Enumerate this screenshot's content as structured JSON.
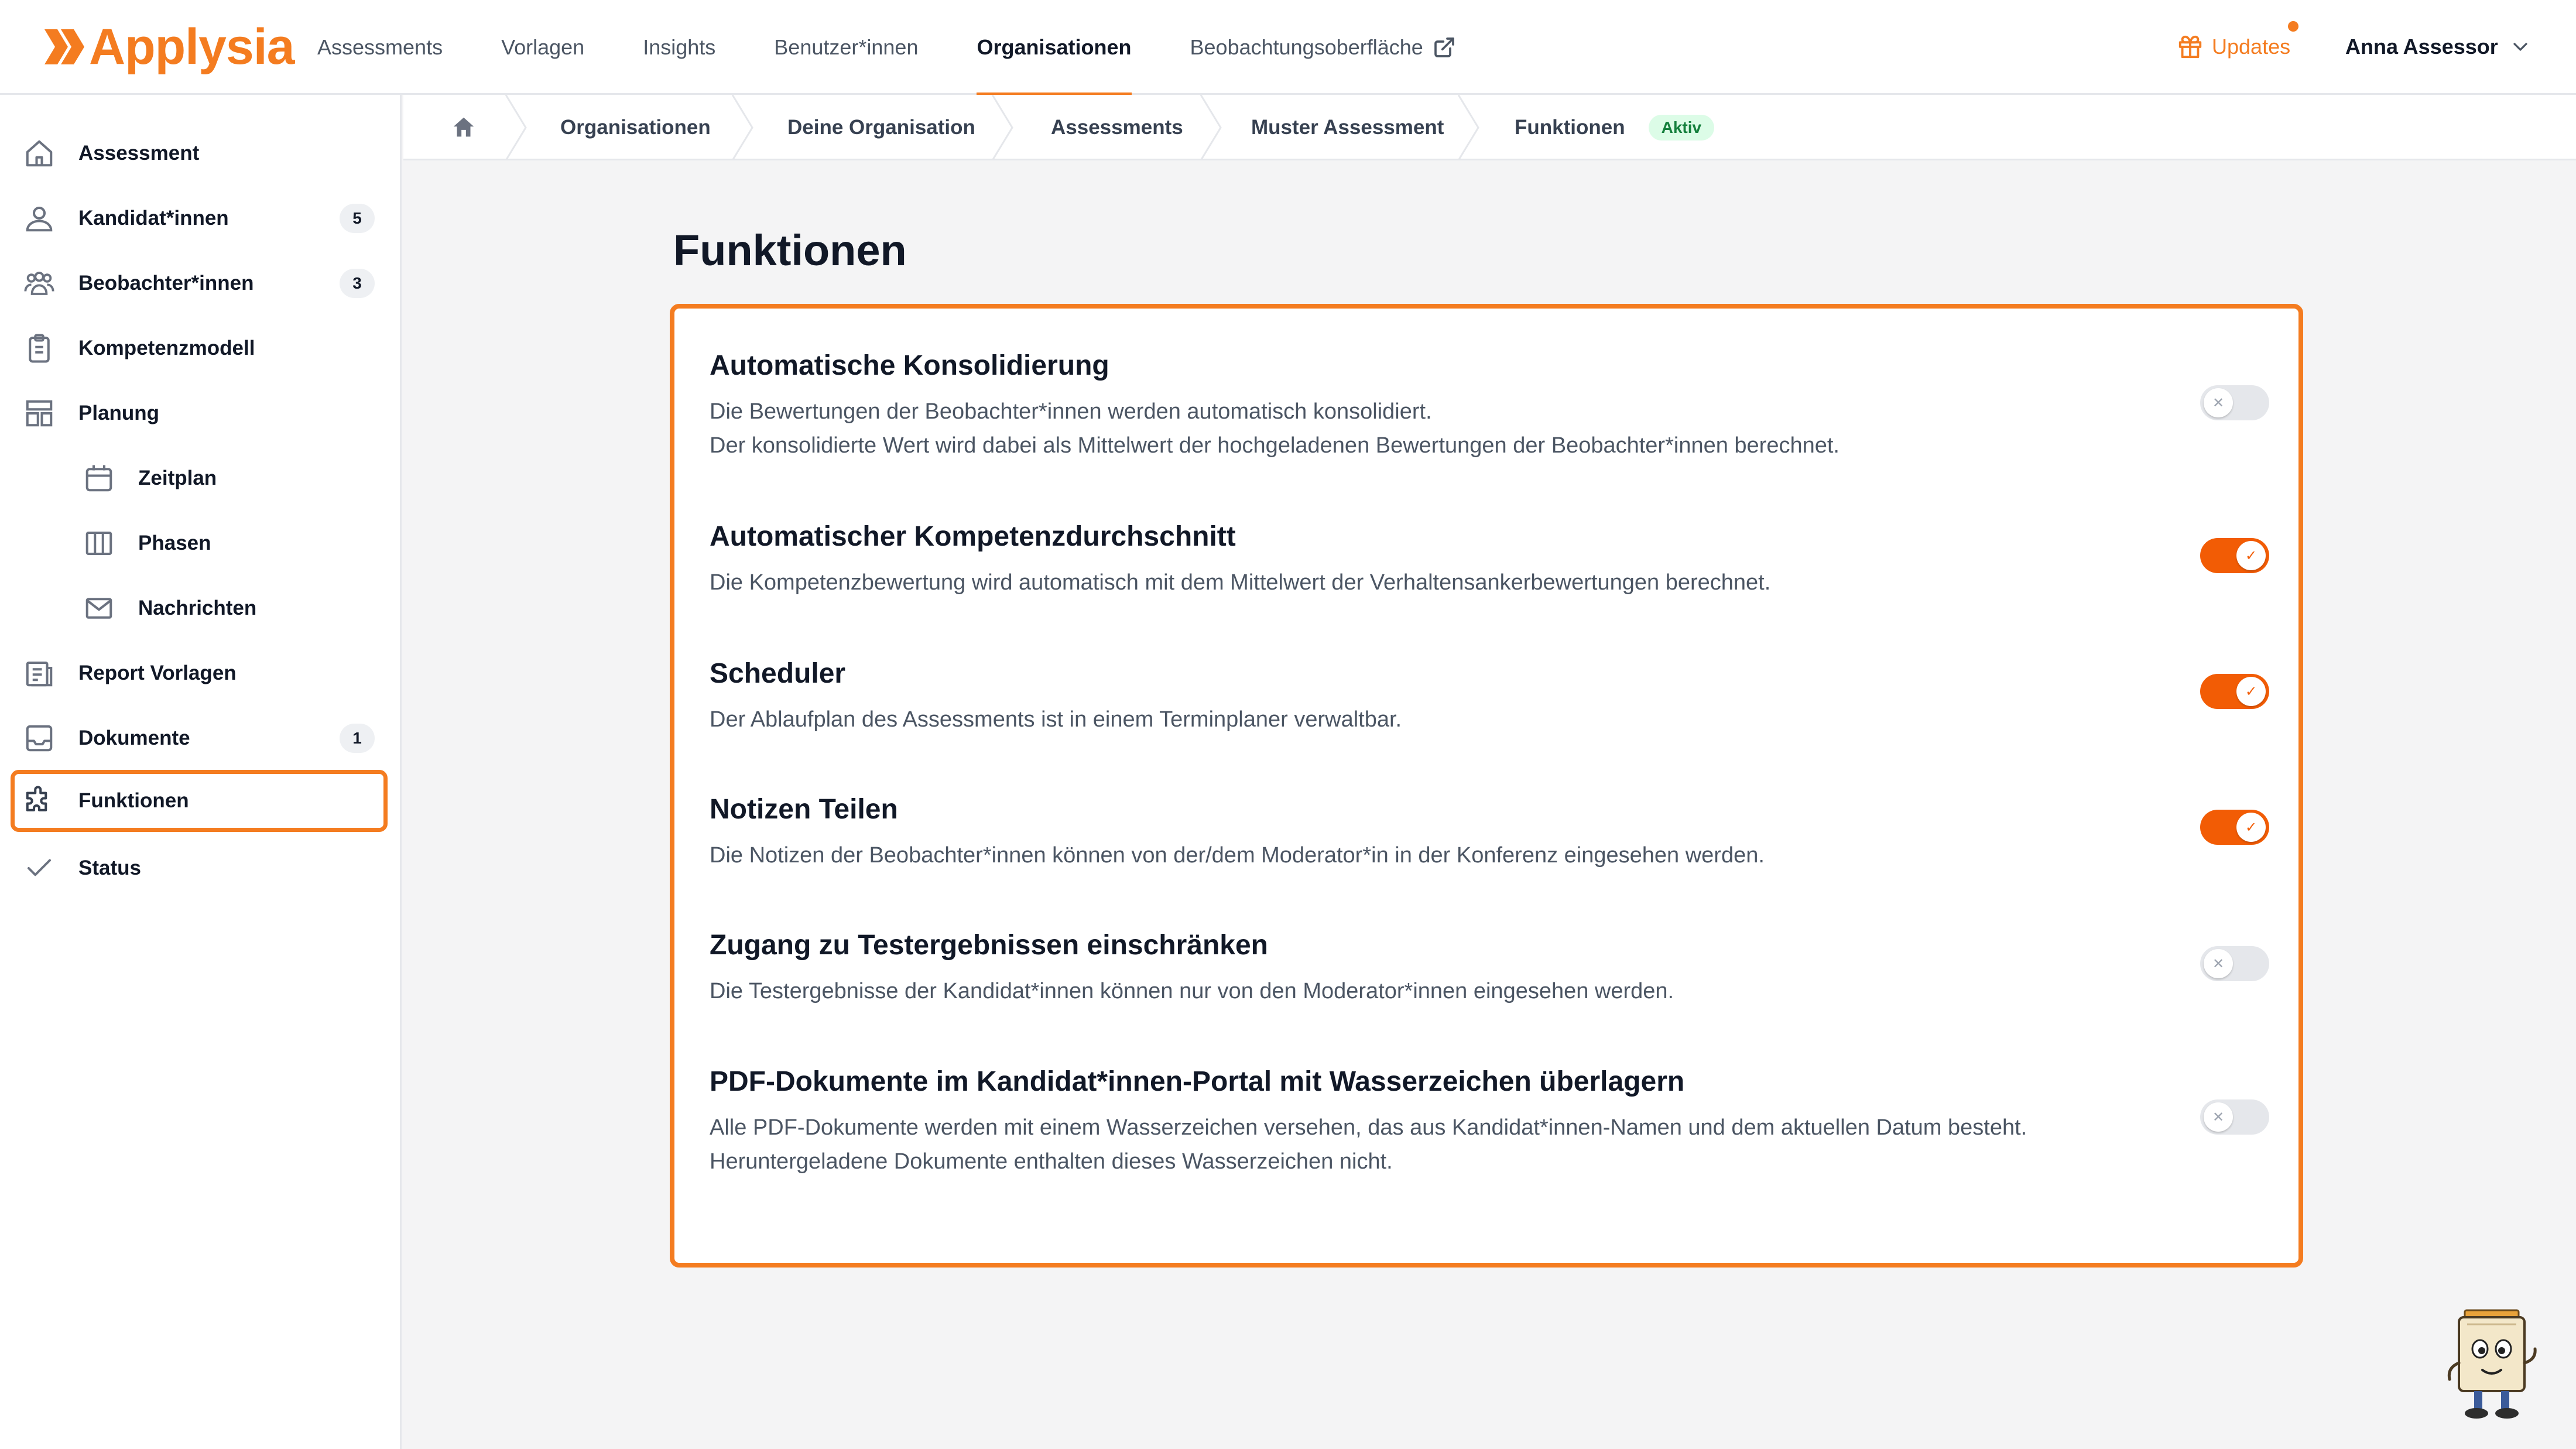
{
  "brand": {
    "name": "Applysia",
    "color": "#f47c20"
  },
  "nav": {
    "items": [
      {
        "label": "Assessments",
        "active": false
      },
      {
        "label": "Vorlagen",
        "active": false
      },
      {
        "label": "Insights",
        "active": false
      },
      {
        "label": "Benutzer*innen",
        "active": false
      },
      {
        "label": "Organisationen",
        "active": true
      },
      {
        "label": "Beobachtungsoberfläche",
        "active": false,
        "icon": "external-link-icon"
      }
    ],
    "updates_label": "Updates",
    "user_name": "Anna Assessor"
  },
  "sidebar": {
    "items": [
      {
        "label": "Assessment",
        "icon": "home-icon"
      },
      {
        "label": "Kandidat*innen",
        "icon": "user-icon",
        "badge": "5"
      },
      {
        "label": "Beobachter*innen",
        "icon": "users-icon",
        "badge": "3"
      },
      {
        "label": "Kompetenzmodell",
        "icon": "clipboard-icon"
      },
      {
        "label": "Planung",
        "icon": "layout-icon"
      },
      {
        "label": "Zeitplan",
        "icon": "calendar-icon",
        "sub": true
      },
      {
        "label": "Phasen",
        "icon": "columns-icon",
        "sub": true
      },
      {
        "label": "Nachrichten",
        "icon": "mail-icon",
        "sub": true
      },
      {
        "label": "Report Vorlagen",
        "icon": "report-icon"
      },
      {
        "label": "Dokumente",
        "icon": "inbox-icon",
        "badge": "1"
      },
      {
        "label": "Funktionen",
        "icon": "puzzle-icon",
        "active": true
      },
      {
        "label": "Status",
        "icon": "check-icon"
      }
    ]
  },
  "breadcrumb": {
    "items": [
      "Organisationen",
      "Deine Organisation",
      "Assessments",
      "Muster Assessment",
      "Funktionen"
    ],
    "status_badge": "Aktiv"
  },
  "page": {
    "title": "Funktionen",
    "features": [
      {
        "title": "Automatische Konsolidierung",
        "desc": [
          "Die Bewertungen der Beobachter*innen werden automatisch konsolidiert.",
          "Der konsolidierte Wert wird dabei als Mittelwert der hochgeladenen Bewertungen der Beobachter*innen berechnet."
        ],
        "enabled": false
      },
      {
        "title": "Automatischer Kompetenzdurchschnitt",
        "desc": [
          "Die Kompetenzbewertung wird automatisch mit dem Mittelwert der Verhaltensankerbewertungen berechnet."
        ],
        "enabled": true
      },
      {
        "title": "Scheduler",
        "desc": [
          "Der Ablaufplan des Assessments ist in einem Terminplaner verwaltbar."
        ],
        "enabled": true
      },
      {
        "title": "Notizen Teilen",
        "desc": [
          "Die Notizen der Beobachter*innen können von der/dem Moderator*in in der Konferenz eingesehen werden."
        ],
        "enabled": true
      },
      {
        "title": "Zugang zu Testergebnissen einschränken",
        "desc": [
          "Die Testergebnisse der Kandidat*innen können nur von den Moderator*innen eingesehen werden."
        ],
        "enabled": false
      },
      {
        "title": "PDF-Dokumente im Kandidat*innen-Portal mit Wasserzeichen überlagern",
        "desc": [
          "Alle PDF-Dokumente werden mit einem Wasserzeichen versehen, das aus Kandidat*innen-Namen und dem aktuellen Datum besteht.",
          "Heruntergeladene Dokumente enthalten dieses Wasserzeichen nicht."
        ],
        "enabled": false
      }
    ]
  },
  "colors": {
    "accent": "#f47c20",
    "toggle_on": "#f25c05",
    "toggle_off": "#e5e7eb",
    "active_badge": "#dcfce7"
  }
}
